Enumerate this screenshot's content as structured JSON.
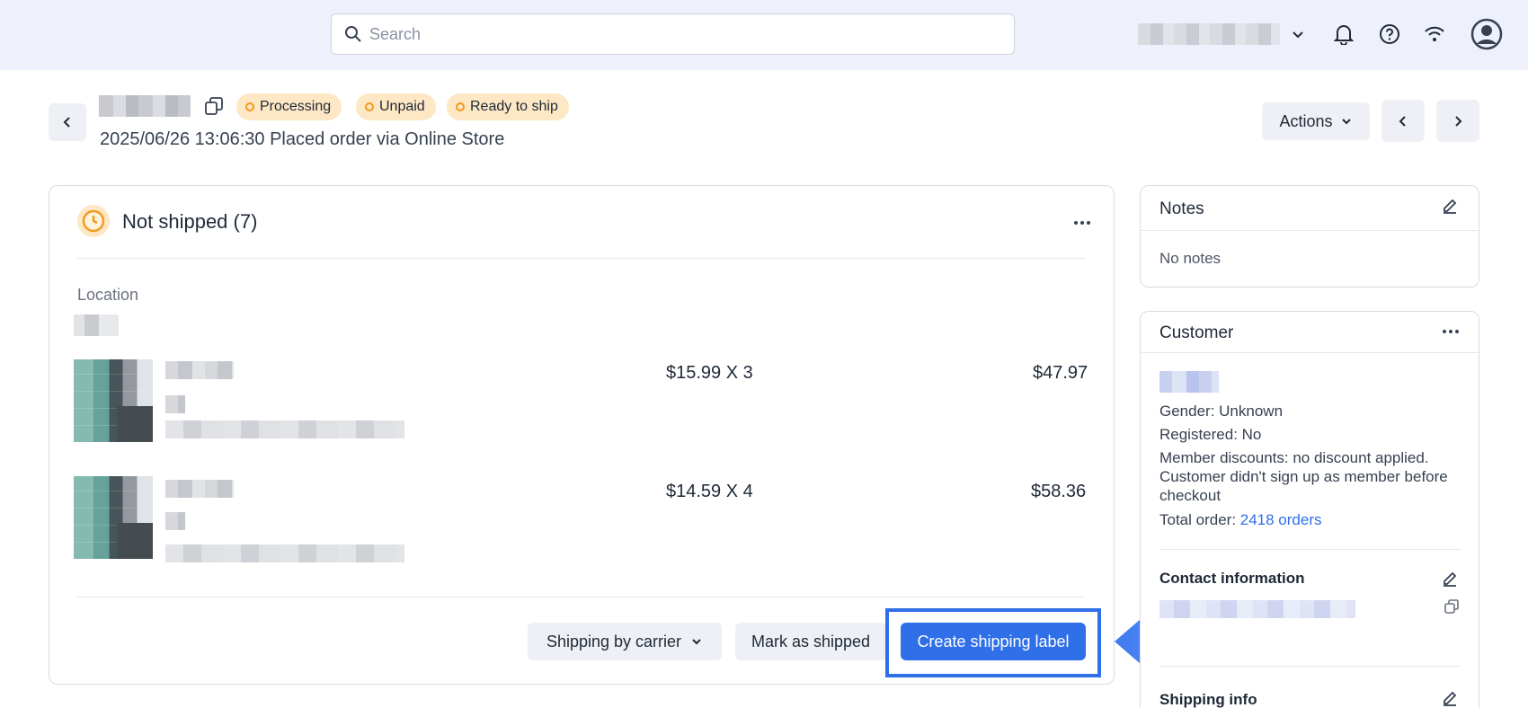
{
  "search": {
    "placeholder": "Search"
  },
  "order": {
    "badges": [
      "Processing",
      "Unpaid",
      "Ready to ship"
    ],
    "subtitle": "2025/06/26 13:06:30 Placed order via Online Store"
  },
  "header_actions": {
    "actions_label": "Actions"
  },
  "shipment": {
    "title": "Not shipped (7)",
    "location_label": "Location",
    "items": [
      {
        "unit_qty": "$15.99 X 3",
        "total": "$47.97"
      },
      {
        "unit_qty": "$14.59 X 4",
        "total": "$58.36"
      }
    ],
    "buttons": {
      "shipping_by_carrier": "Shipping by carrier",
      "mark_as_shipped": "Mark as shipped",
      "create_label": "Create shipping label"
    }
  },
  "notes": {
    "title": "Notes",
    "body": "No notes"
  },
  "customer": {
    "title": "Customer",
    "gender": "Gender: Unknown",
    "registered": "Registered: No",
    "member_discounts": "Member discounts: no discount applied. Customer didn't sign up as member before checkout",
    "total_order_label": "Total order: ",
    "total_order_link": "2418 orders",
    "contact_title": "Contact information",
    "shipping_info_title": "Shipping info"
  },
  "colors": {
    "primary": "#2f6fe8",
    "badge_bg": "#fde7c4",
    "badge_dot": "#f29a1c",
    "topbar_bg": "#eef1fb"
  },
  "icons": [
    "search-icon",
    "chevron-down-icon",
    "bell-icon",
    "help-icon",
    "wifi-icon",
    "user-avatar-icon",
    "chevron-left-icon",
    "copy-icon",
    "chevron-right-icon",
    "clock-icon",
    "more-icon",
    "edit-icon"
  ]
}
